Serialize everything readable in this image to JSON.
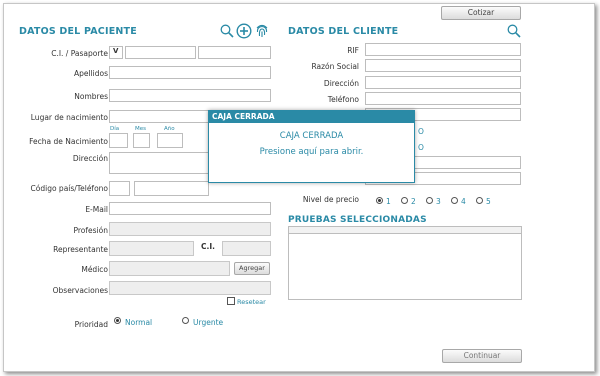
{
  "top_button": "Cotizar",
  "paciente": {
    "title": "DATOS DEL PACIENTE",
    "ci_label": "C.I. / Pasaporte",
    "ci_prefix": "V",
    "apellidos_label": "Apellidos",
    "nombres_label": "Nombres",
    "lugar_label": "Lugar de nacimiento",
    "fecha_label": "Fecha de Nacimiento",
    "dia_label": "Día",
    "mes_label": "Mes",
    "ano_label": "Año",
    "direccion_label": "Dirección",
    "codigo_label": "Código país/Teléfono",
    "email_label": "E-Mail",
    "profesion_label": "Profesión",
    "representante_label": "Representante",
    "rep_ci_label": "C.I.",
    "medico_label": "Médico",
    "agregar_label": "Agregar",
    "observaciones_label": "Observaciones",
    "resetear_label": "Resetear",
    "prioridad_label": "Prioridad",
    "normal_label": "Normal",
    "urgente_label": "Urgente"
  },
  "cliente": {
    "title": "DATOS DEL CLIENTE",
    "rif_label": "RIF",
    "razon_label": "Razón Social",
    "direccion_label": "Dirección",
    "telefono_label": "Teléfono",
    "nivel_label": "Nivel de precio",
    "niveles": [
      "1",
      "2",
      "3",
      "4",
      "5"
    ],
    "partial_text_1": "O",
    "partial_text_2": "O"
  },
  "pruebas": {
    "title": "PRUEBAS SELECCIONADAS"
  },
  "modal": {
    "header": "CAJA CERRADA",
    "line1": "CAJA CERRADA",
    "line2": "Presione aquí para abrir."
  },
  "bottom_button": "Continuar",
  "colors": {
    "accent": "#2a8aa6"
  },
  "icons": [
    "search-icon",
    "add-circle-icon",
    "fingerprint-icon",
    "search-icon"
  ]
}
